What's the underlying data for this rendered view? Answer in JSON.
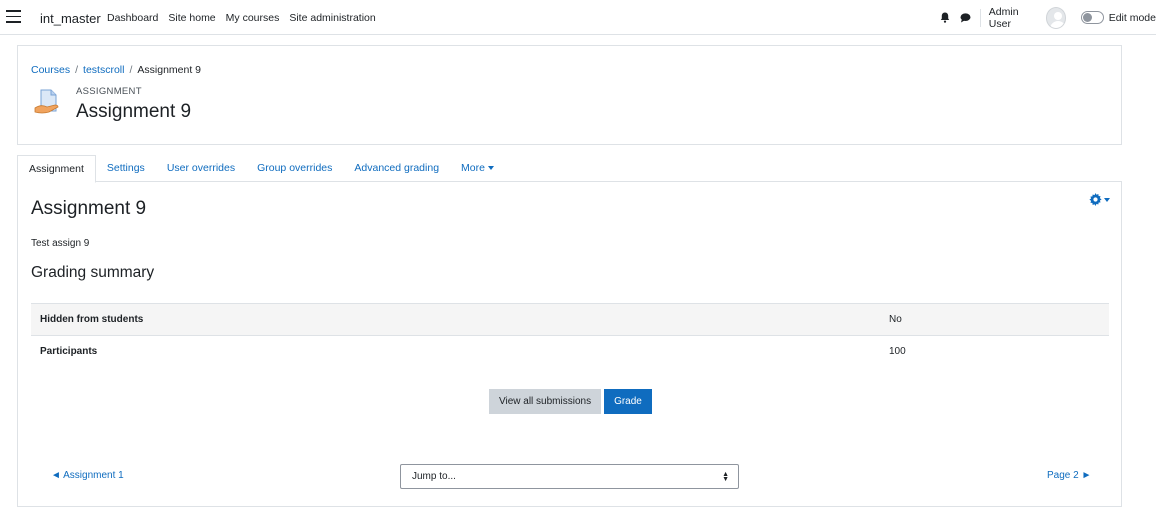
{
  "navbar": {
    "brand": "int_master",
    "items": [
      "Dashboard",
      "Site home",
      "My courses",
      "Site administration"
    ],
    "user_name": "Admin User",
    "edit_mode_label": "Edit mode"
  },
  "breadcrumb": [
    "Courses",
    "testscroll",
    "Assignment 9"
  ],
  "header": {
    "activity_type": "ASSIGNMENT",
    "title": "Assignment 9"
  },
  "tabs": [
    "Assignment",
    "Settings",
    "User overrides",
    "Group overrides",
    "Advanced grading",
    "More"
  ],
  "main": {
    "title": "Assignment 9",
    "intro": "Test assign 9",
    "summary_heading": "Grading summary",
    "summary_rows": [
      {
        "label": "Hidden from students",
        "value": "No"
      },
      {
        "label": "Participants",
        "value": "100"
      }
    ],
    "view_all_label": "View all submissions",
    "grade_label": "Grade"
  },
  "footer_nav": {
    "prev": "◄ Assignment 1",
    "jump_placeholder": "Jump to...",
    "next": "Page 2 ►"
  },
  "colors": {
    "link": "#0f6cbf",
    "primary_button": "#0f6cbf",
    "secondary_button": "#ced4da"
  }
}
